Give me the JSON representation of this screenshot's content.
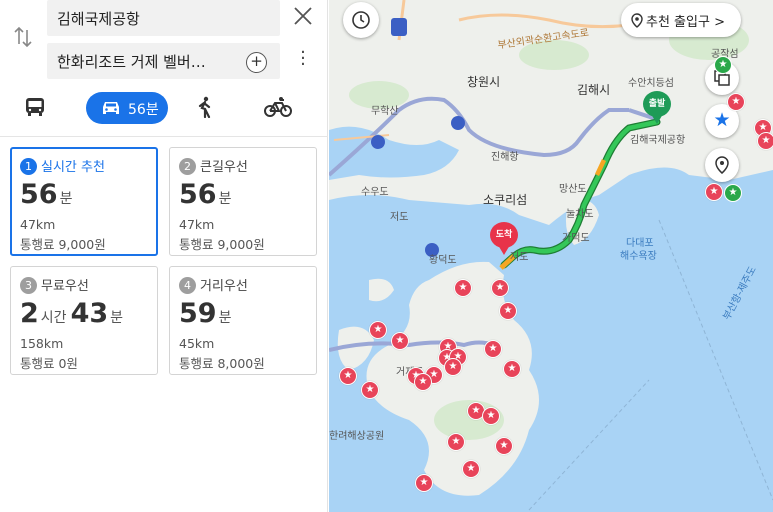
{
  "search": {
    "origin": "김해국제공항",
    "destination": "한화리조트 거제 벨버…"
  },
  "modes": {
    "car_time": "56분"
  },
  "routes": [
    {
      "num": "1",
      "label": "실시간 추천",
      "time_value": "56",
      "time_unit": "분",
      "distance": "47km",
      "toll": "통행료 9,000원"
    },
    {
      "num": "2",
      "label": "큰길우선",
      "time_value": "56",
      "time_unit": "분",
      "distance": "47km",
      "toll": "통행료 9,000원"
    },
    {
      "num": "3",
      "label": "무료우선",
      "hours_value": "2",
      "hours_unit": "시간",
      "time_value": "43",
      "time_unit": "분",
      "distance": "158km",
      "toll": "통행료 0원"
    },
    {
      "num": "4",
      "label": "거리우선",
      "time_value": "59",
      "time_unit": "분",
      "distance": "45km",
      "toll": "통행료 8,000원"
    }
  ],
  "map": {
    "recommended_entrance": "추천 출입구",
    "start_flag": "출발",
    "end_flag": "도착",
    "labels": {
      "changwon": "창원시",
      "gimhae": "김해시",
      "suan": "수안치등섬",
      "gimhae_airport": "김해국제공항",
      "muhaksan": "무학산",
      "jinhae": "진해항",
      "sokuri": "소쿠리섬",
      "mangsan": "망산도",
      "suudo": "수우도",
      "jeodo": "저도",
      "nulchado": "눌차도",
      "gadeokdo": "가덕도",
      "hwangdeokdo": "황덕도",
      "jeodo2": "저도",
      "geojedo": "거제도",
      "dadaepo": "다대포",
      "dadaepo_beach": "해수욕장",
      "hallyeo": "한려해상공원",
      "busan_jeju": "부산항-제주도",
      "gongjeom": "공작섬",
      "expressway": "부산외곽순환고속도로"
    }
  },
  "colors": {
    "accent": "#1a73e8",
    "route_green": "#34c759",
    "route_orange": "#f5a623",
    "start_green": "#1e9b57",
    "end_red": "#e8334a",
    "sea": "#a9d3f5"
  }
}
